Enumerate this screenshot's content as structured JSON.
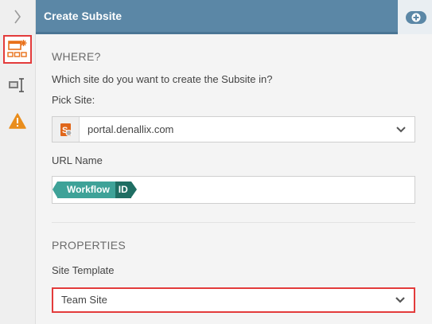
{
  "header": {
    "title": "Create Subsite",
    "action_icon": "add-icon"
  },
  "rail": {
    "items": [
      {
        "icon": "chevron-right-icon"
      },
      {
        "icon": "subsite-grid-icon",
        "active": true,
        "highlight_color": "#e33b3b"
      },
      {
        "icon": "text-cursor-field-icon"
      },
      {
        "icon": "warning-icon",
        "color": "#e98d1c"
      }
    ]
  },
  "where": {
    "title": "WHERE?",
    "question": "Which site do you want to create the Subsite in?",
    "pick_label": "Pick Site:",
    "site_value": "portal.denallix.com",
    "url_label": "URL Name",
    "tokens": [
      {
        "label": "Workflow"
      },
      {
        "label": "ID"
      }
    ]
  },
  "properties": {
    "title": "PROPERTIES",
    "template_label": "Site Template",
    "template_value": "Team Site"
  },
  "colors": {
    "header": "#5b87a6",
    "token_primary": "#3ea298",
    "token_secondary": "#1f6e63",
    "highlight": "#e33b3b"
  }
}
